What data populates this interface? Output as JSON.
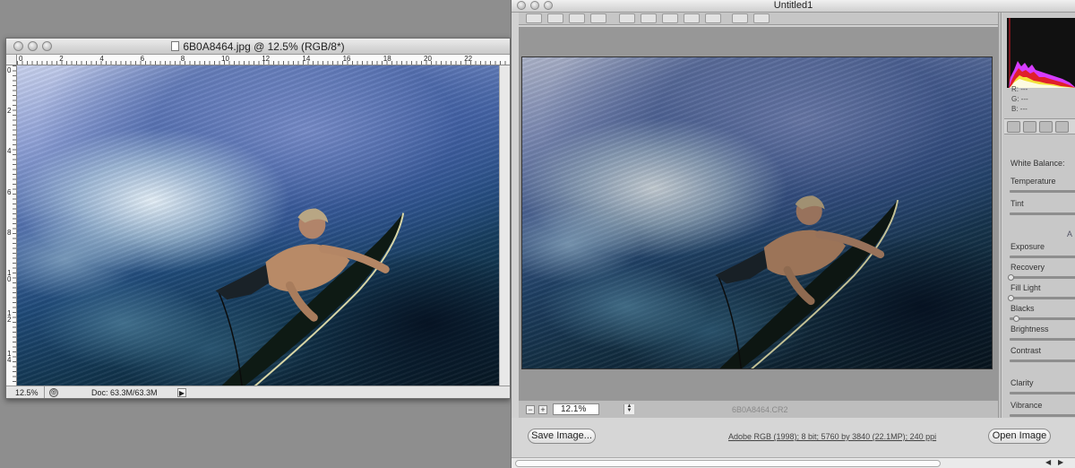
{
  "doc_window": {
    "title": "6B0A8464.jpg @ 12.5% (RGB/8*)",
    "ruler_h": [
      "0",
      "2",
      "4",
      "6",
      "8",
      "10",
      "12",
      "14",
      "16",
      "18",
      "20",
      "22"
    ],
    "ruler_v": [
      "0",
      "2",
      "4",
      "6",
      "8",
      "1\n0",
      "1\n2",
      "1\n4"
    ],
    "zoom": "12.5%",
    "doc_size": "Doc: 63.3M/63.3M",
    "photo": "photo-surfer-underwater-icon"
  },
  "acr_window": {
    "title": "Untitled1",
    "zoom_value": "12.1%",
    "zoom_minus": "−",
    "zoom_plus": "+",
    "filename": "6B0A8464.CR2",
    "save_button": "Save Image...",
    "workflow_options": "Adobe RGB (1998); 8 bit; 5760 by 3840 (22.1MP); 240 ppi",
    "open_button": "Open Image",
    "rgb_readout": {
      "r": "R:  ---",
      "g": "G:  ---",
      "b": "B:  ---"
    },
    "adjustments": {
      "white_balance": "White Balance:",
      "temperature": "Temperature",
      "tint": "Tint",
      "auto_label": "A",
      "exposure": "Exposure",
      "recovery": "Recovery",
      "fill_light": "Fill Light",
      "blacks": "Blacks",
      "brightness": "Brightness",
      "contrast": "Contrast",
      "clarity": "Clarity",
      "vibrance": "Vibrance"
    },
    "accent_colors": {
      "histogram_red": "#e0202a",
      "histogram_yellow": "#f2e23a",
      "histogram_magenta": "#d63cff"
    }
  }
}
